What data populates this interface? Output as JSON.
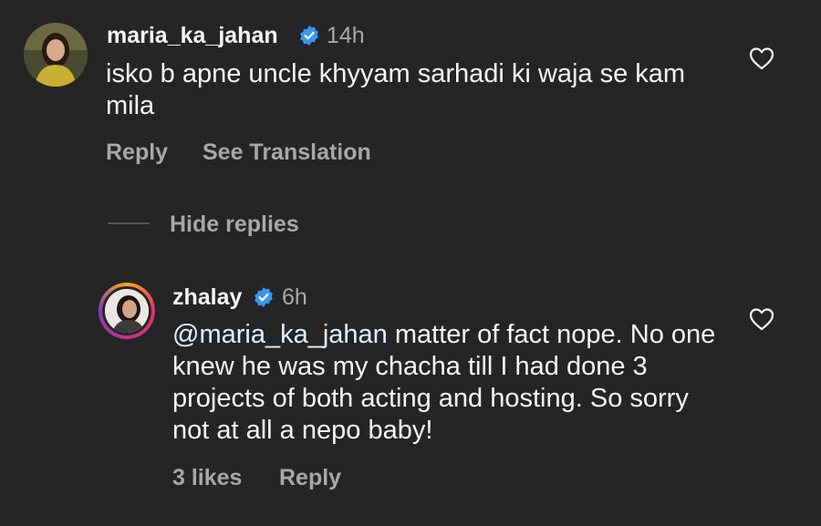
{
  "comment": {
    "username": "maria_ka_jahan",
    "time": "14h",
    "text": "isko b apne uncle khyyam sarhadi ki waja se kam mila",
    "reply_label": "Reply",
    "translate_label": "See Translation"
  },
  "hide_replies_label": "Hide replies",
  "reply": {
    "username": "zhalay",
    "time": "6h",
    "mention": "@maria_ka_jahan",
    "text": " matter of fact nope. No one knew he was my chacha till I had done 3 projects of both acting and hosting. So sorry not at all a nepo baby!",
    "likes_label": "3 likes",
    "reply_label": "Reply"
  },
  "colors": {
    "background": "#252526",
    "verified": "#3897f0",
    "muted": "#a8a8a8"
  },
  "icons": [
    "verified-badge-icon",
    "heart-icon"
  ]
}
